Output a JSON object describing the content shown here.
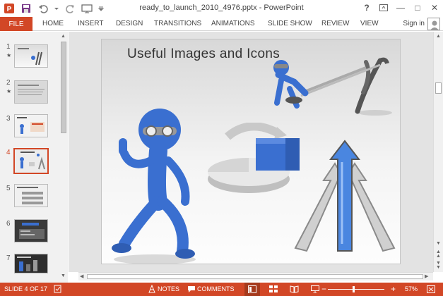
{
  "window": {
    "title": "ready_to_launch_2010_4976.pptx - PowerPoint",
    "help": "?",
    "minimize": "—",
    "restore": "□",
    "close": "✕"
  },
  "ribbon": {
    "file": "FILE",
    "tabs": [
      "HOME",
      "INSERT",
      "DESIGN",
      "TRANSITIONS",
      "ANIMATIONS",
      "SLIDE SHOW",
      "REVIEW",
      "VIEW"
    ],
    "sign_in": "Sign in"
  },
  "thumbnails": [
    {
      "number": "1",
      "star": "★"
    },
    {
      "number": "2",
      "star": "★"
    },
    {
      "number": "3",
      "star": ""
    },
    {
      "number": "4",
      "star": ""
    },
    {
      "number": "5",
      "star": ""
    },
    {
      "number": "6",
      "star": ""
    },
    {
      "number": "7",
      "star": ""
    }
  ],
  "selected_slide": 4,
  "slide": {
    "title": "Useful Images and Icons"
  },
  "status": {
    "slide_info": "SLIDE 4 OF 17",
    "notes": "NOTES",
    "comments": "COMMENTS",
    "zoom": "57%"
  },
  "colors": {
    "accent": "#d24726",
    "figure_blue": "#3a6fd0",
    "pane_bg": "#f1f1f1",
    "edit_bg": "#e3e3e3"
  }
}
